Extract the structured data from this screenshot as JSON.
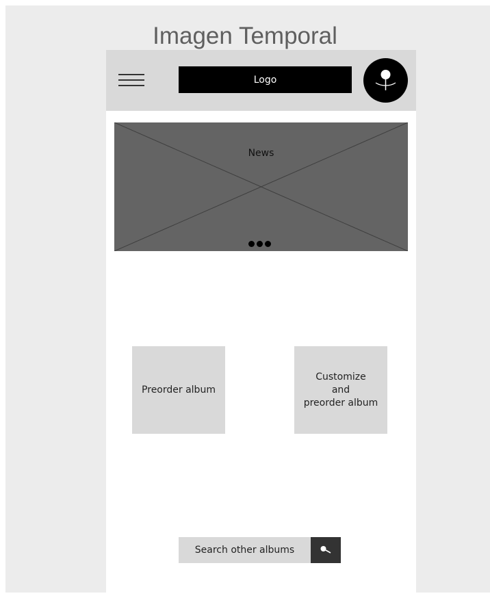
{
  "page": {
    "title": "Imagen Temporal"
  },
  "header": {
    "menu_icon": "hamburger-menu-icon",
    "logo_label": "Logo",
    "avatar_icon": "flower-avatar-icon"
  },
  "news": {
    "label": "News",
    "carousel_dots": 3
  },
  "cards": {
    "preorder_label": "Preorder album",
    "customize_label": "Customize\nand\npreorder album"
  },
  "search": {
    "label": "Search other albums",
    "icon": "search-icon"
  },
  "colors": {
    "background": "#ececec",
    "header": "#d9d9d9",
    "news_placeholder": "#646464",
    "logo": "#000000",
    "search_button": "#333333"
  }
}
